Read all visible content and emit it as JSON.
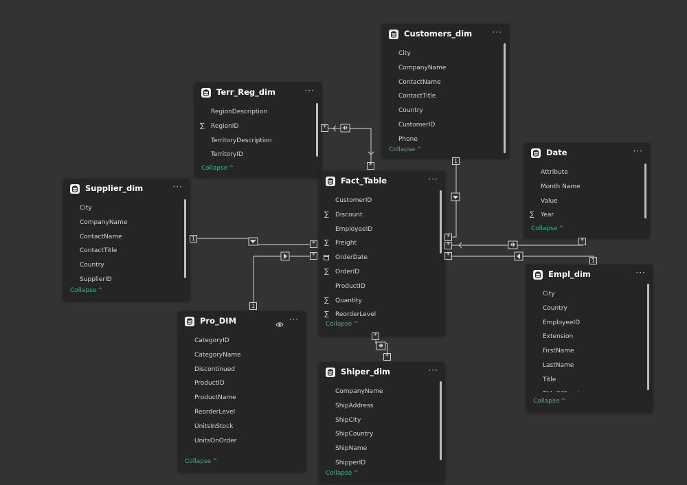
{
  "tables": [
    {
      "key": "customers",
      "title": "Customers_dim",
      "collapse": "Collapse",
      "fields": [
        {
          "name": "City",
          "type": "text"
        },
        {
          "name": "CompanyName",
          "type": "text"
        },
        {
          "name": "ContactName",
          "type": "text"
        },
        {
          "name": "ContactTitle",
          "type": "text"
        },
        {
          "name": "Country",
          "type": "text"
        },
        {
          "name": "CustomerID",
          "type": "text"
        },
        {
          "name": "Phone",
          "type": "text"
        }
      ]
    },
    {
      "key": "terr",
      "title": "Terr_Reg_dim",
      "collapse": "Collapse",
      "fields": [
        {
          "name": "RegionDescription",
          "type": "text"
        },
        {
          "name": "RegionID",
          "type": "sum"
        },
        {
          "name": "TerritoryDescription",
          "type": "text"
        },
        {
          "name": "TerritoryID",
          "type": "text"
        }
      ]
    },
    {
      "key": "date",
      "title": "Date",
      "collapse": "Collapse",
      "fields": [
        {
          "name": "Attribute",
          "type": "text"
        },
        {
          "name": "Month Name",
          "type": "text"
        },
        {
          "name": "Value",
          "type": "text"
        },
        {
          "name": "Year",
          "type": "sum"
        }
      ]
    },
    {
      "key": "supplier",
      "title": "Supplier_dim",
      "collapse": "Collapse",
      "fields": [
        {
          "name": "City",
          "type": "text"
        },
        {
          "name": "CompanyName",
          "type": "text"
        },
        {
          "name": "ContactName",
          "type": "text"
        },
        {
          "name": "ContactTitle",
          "type": "text"
        },
        {
          "name": "Country",
          "type": "text"
        },
        {
          "name": "SupplierID",
          "type": "text"
        }
      ]
    },
    {
      "key": "fact",
      "title": "Fact_Table",
      "collapse": "Collapse",
      "fields": [
        {
          "name": "CustomerID",
          "type": "text"
        },
        {
          "name": "Discount",
          "type": "sum"
        },
        {
          "name": "EmployeeID",
          "type": "text"
        },
        {
          "name": "Freight",
          "type": "sum"
        },
        {
          "name": "OrderDate",
          "type": "date"
        },
        {
          "name": "OrderID",
          "type": "sum"
        },
        {
          "name": "ProductID",
          "type": "text"
        },
        {
          "name": "Quantity",
          "type": "sum"
        },
        {
          "name": "ReorderLevel",
          "type": "sum"
        }
      ]
    },
    {
      "key": "empl",
      "title": "Empl_dim",
      "collapse": "Collapse",
      "fields": [
        {
          "name": "City",
          "type": "text"
        },
        {
          "name": "Country",
          "type": "text"
        },
        {
          "name": "EmployeeID",
          "type": "text"
        },
        {
          "name": "Extension",
          "type": "text"
        },
        {
          "name": "FirstName",
          "type": "text"
        },
        {
          "name": "LastName",
          "type": "text"
        },
        {
          "name": "Title",
          "type": "text"
        },
        {
          "name": "TitleOfCourtesy",
          "type": "text"
        }
      ]
    },
    {
      "key": "prod",
      "title": "Pro_DIM",
      "collapse": "Collapse",
      "fields": [
        {
          "name": "CategoryID",
          "type": "text"
        },
        {
          "name": "CategoryName",
          "type": "text"
        },
        {
          "name": "Discontinued",
          "type": "text"
        },
        {
          "name": "ProductID",
          "type": "text"
        },
        {
          "name": "ProductName",
          "type": "text"
        },
        {
          "name": "ReorderLevel",
          "type": "text"
        },
        {
          "name": "UnitsInStock",
          "type": "text"
        },
        {
          "name": "UnitsOnOrder",
          "type": "text"
        }
      ]
    },
    {
      "key": "shipper",
      "title": "Shiper_dim",
      "collapse": "Collapse",
      "fields": [
        {
          "name": "CompanyName",
          "type": "text"
        },
        {
          "name": "ShipAddress",
          "type": "text"
        },
        {
          "name": "ShipCity",
          "type": "text"
        },
        {
          "name": "ShipCountry",
          "type": "text"
        },
        {
          "name": "ShipName",
          "type": "text"
        },
        {
          "name": "ShipperID",
          "type": "text"
        }
      ]
    }
  ],
  "symbols": {
    "many": "*",
    "one": "1",
    "more": "···",
    "sigma": "∑",
    "chevron": "^"
  },
  "icons": {
    "table": "table-icon",
    "more": "more-options-icon",
    "eye": "eye-icon",
    "sum": "sigma-icon",
    "date": "calendar-icon"
  },
  "colors": {
    "background": "#333333",
    "card": "#252525",
    "accent": "#3fb58a",
    "line": "#bdbdbd"
  }
}
